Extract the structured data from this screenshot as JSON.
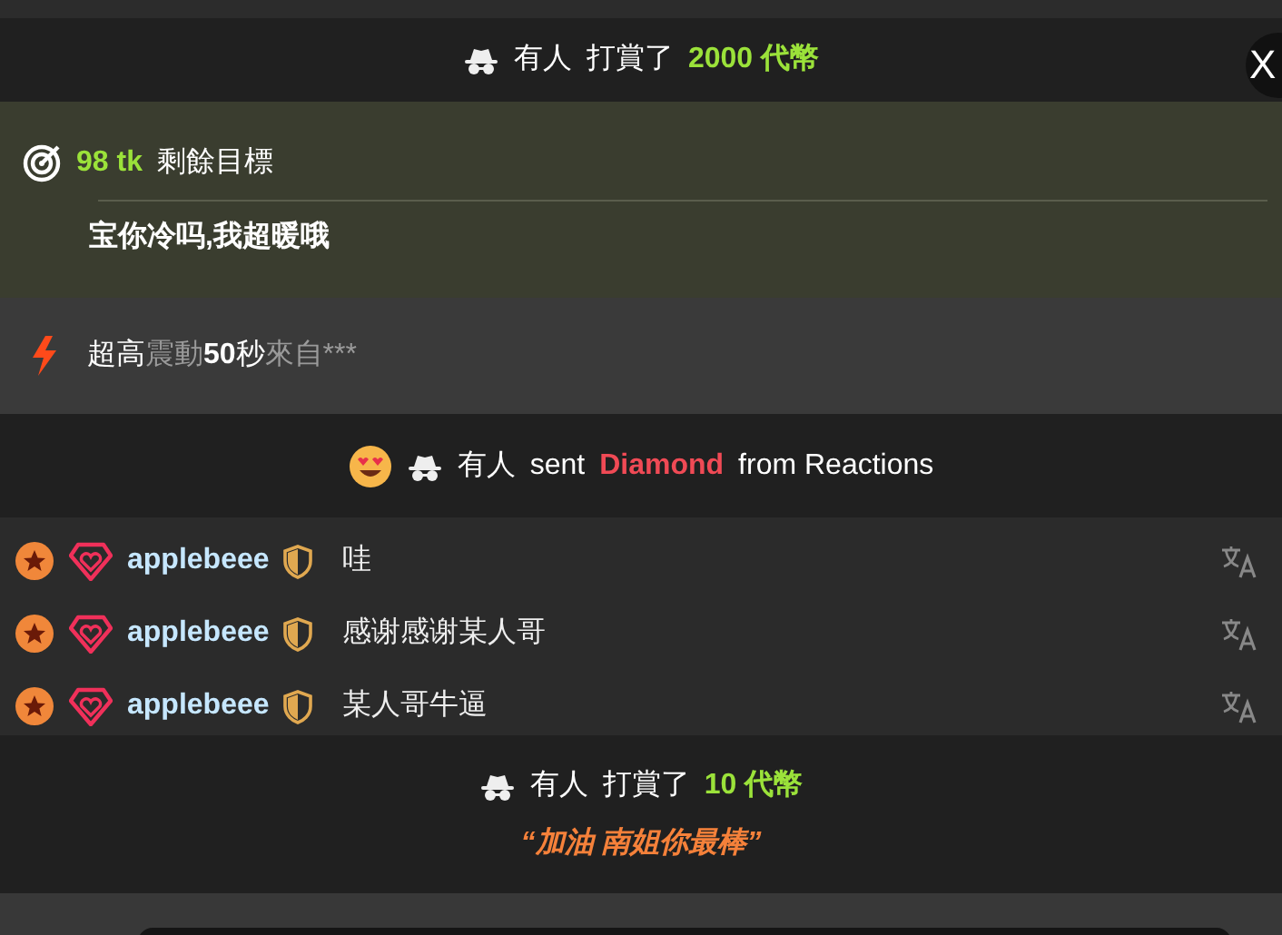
{
  "close_button": {
    "label": "X"
  },
  "feed": [
    {
      "kind": "tip",
      "sender": "有人",
      "action": "打賞了",
      "amount": "2000 代幣"
    },
    {
      "kind": "goal",
      "amount": "98 tk",
      "label": "剩餘目標",
      "subject": "宝你冷吗,我超暖哦"
    },
    {
      "kind": "vibe",
      "strength": "超高",
      "verb": "震動",
      "seconds": "50",
      "unit": "秒",
      "source": "來自***"
    },
    {
      "kind": "reaction",
      "sender": "有人",
      "action": "sent",
      "gift": "Diamond",
      "source": "from Reactions"
    },
    {
      "kind": "chat",
      "messages": [
        {
          "username": "applebeee",
          "text": "哇"
        },
        {
          "username": "applebeee",
          "text": "感谢感谢某人哥"
        },
        {
          "username": "applebeee",
          "text": "某人哥牛逼"
        }
      ]
    },
    {
      "kind": "tip",
      "sender": "有人",
      "action": "打賞了",
      "amount": "10 代幣",
      "note": "“加油 南姐你最棒”"
    }
  ]
}
